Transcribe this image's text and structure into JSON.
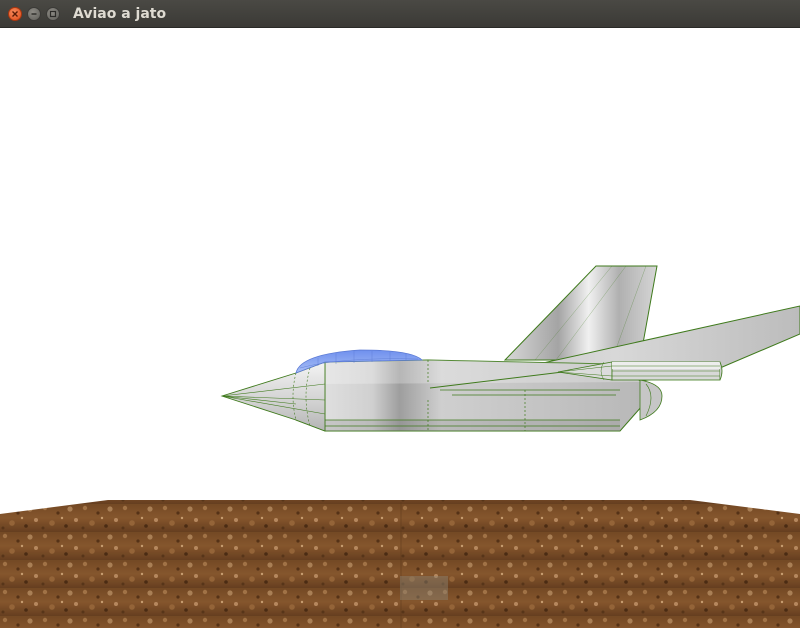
{
  "window": {
    "title": "Aviao a jato"
  },
  "titlebar_buttons": {
    "close_icon": "close-icon",
    "minimize_icon": "minimize-icon",
    "maximize_icon": "maximize-icon"
  },
  "scene": {
    "sky_color": "#ffffff",
    "jet_body_color": "#c8c8c8",
    "wireframe_color": "#3f7a1c",
    "canopy_color": "#7d9ef0",
    "ground_color": "#8c5a2e"
  }
}
